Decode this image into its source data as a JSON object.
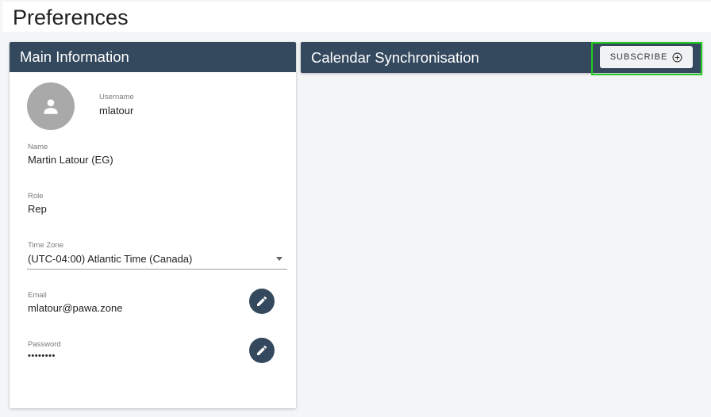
{
  "page": {
    "title": "Preferences"
  },
  "main_info": {
    "header": "Main Information",
    "avatar_icon": "person-icon",
    "username": {
      "label": "Username",
      "value": "mlatour"
    },
    "name": {
      "label": "Name",
      "value": "Martin Latour (EG)"
    },
    "role": {
      "label": "Role",
      "value": "Rep"
    },
    "timezone": {
      "label": "Time Zone",
      "value": "(UTC-04:00) Atlantic Time (Canada)"
    },
    "email": {
      "label": "Email",
      "value": "mlatour@pawa.zone",
      "edit_icon": "pencil-icon"
    },
    "password": {
      "label": "Password",
      "value": "••••••••",
      "edit_icon": "pencil-icon"
    }
  },
  "calendar_sync": {
    "header": "Calendar Synchronisation",
    "subscribe_label": "SUBSCRIBE",
    "subscribe_icon": "add-circle-icon"
  },
  "colors": {
    "header_bg": "#34495e",
    "highlight": "#22cc22",
    "avatar_bg": "#a9a9a9"
  }
}
